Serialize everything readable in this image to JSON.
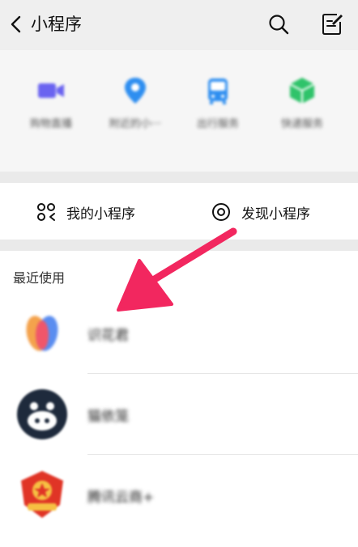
{
  "header": {
    "title": "小程序",
    "icons": [
      "back-icon",
      "search-icon",
      "note-icon"
    ]
  },
  "services": [
    {
      "label": "购物直播",
      "icon": "video-camera-icon",
      "color": "#6a63f0"
    },
    {
      "label": "附近的小···",
      "icon": "location-pin-icon",
      "color": "#2e8ef0"
    },
    {
      "label": "出行服务",
      "icon": "bus-icon",
      "color": "#2e8ef0"
    },
    {
      "label": "快递服务",
      "icon": "package-box-icon",
      "color": "#2fc36a"
    }
  ],
  "links": {
    "my_mini_programs": "我的小程序",
    "discover": "发现小程序"
  },
  "recent": {
    "label": "最近使用",
    "items": [
      {
        "name": "识花君"
      },
      {
        "name": "猫依笼"
      },
      {
        "name": "腾讯云商+"
      }
    ]
  },
  "colors": {
    "arrow": "#f2275f",
    "header_bg": "#efefef",
    "section_gap": "#eaeaea"
  }
}
